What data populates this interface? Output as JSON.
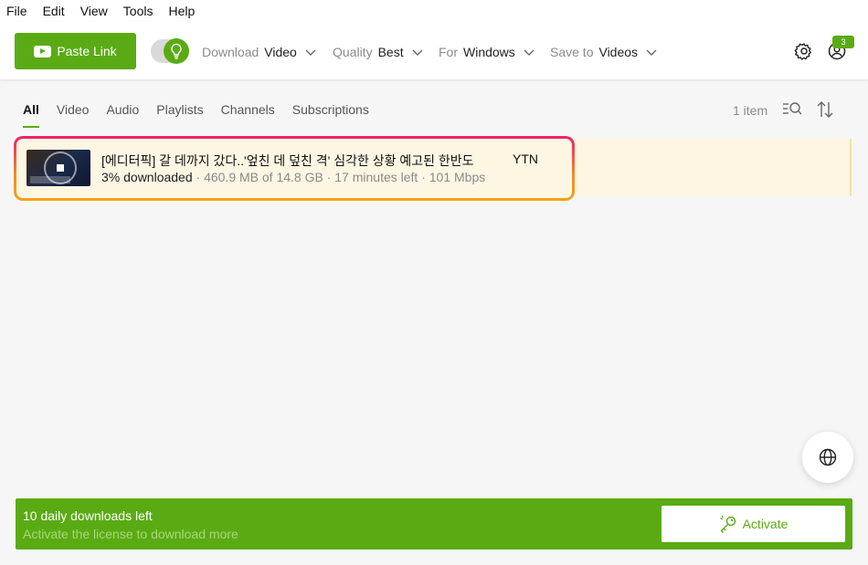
{
  "menu": {
    "items": [
      "File",
      "Edit",
      "View",
      "Tools",
      "Help"
    ]
  },
  "toolbar": {
    "paste_label": "Paste Link",
    "download_label": "Download",
    "download_value": "Video",
    "quality_label": "Quality",
    "quality_value": "Best",
    "for_label": "For",
    "for_value": "Windows",
    "save_label": "Save to",
    "save_value": "Videos",
    "badge_count": "3"
  },
  "tabs": [
    "All",
    "Video",
    "Audio",
    "Playlists",
    "Channels",
    "Subscriptions"
  ],
  "list": {
    "item_count": "1 item"
  },
  "download": {
    "title": "[에디터픽] 갈 데까지 갔다..'엎친 데 덮친 격' 심각한 상황 예고된 한반도",
    "channel": "YTN",
    "progress_text": "3% downloaded",
    "progress_fraction": 0.03,
    "details": "· 460.9 MB of 14.8 GB · 17 minutes left · 101 Mbps"
  },
  "banner": {
    "title": "10 daily downloads left",
    "subtitle": "Activate the license to download more",
    "activate_label": "Activate"
  },
  "colors": {
    "accent": "#5aab13",
    "row_bg": "#fdf6e3",
    "highlight_top": "#ee1f6b",
    "highlight_bottom": "#f7a21a"
  }
}
